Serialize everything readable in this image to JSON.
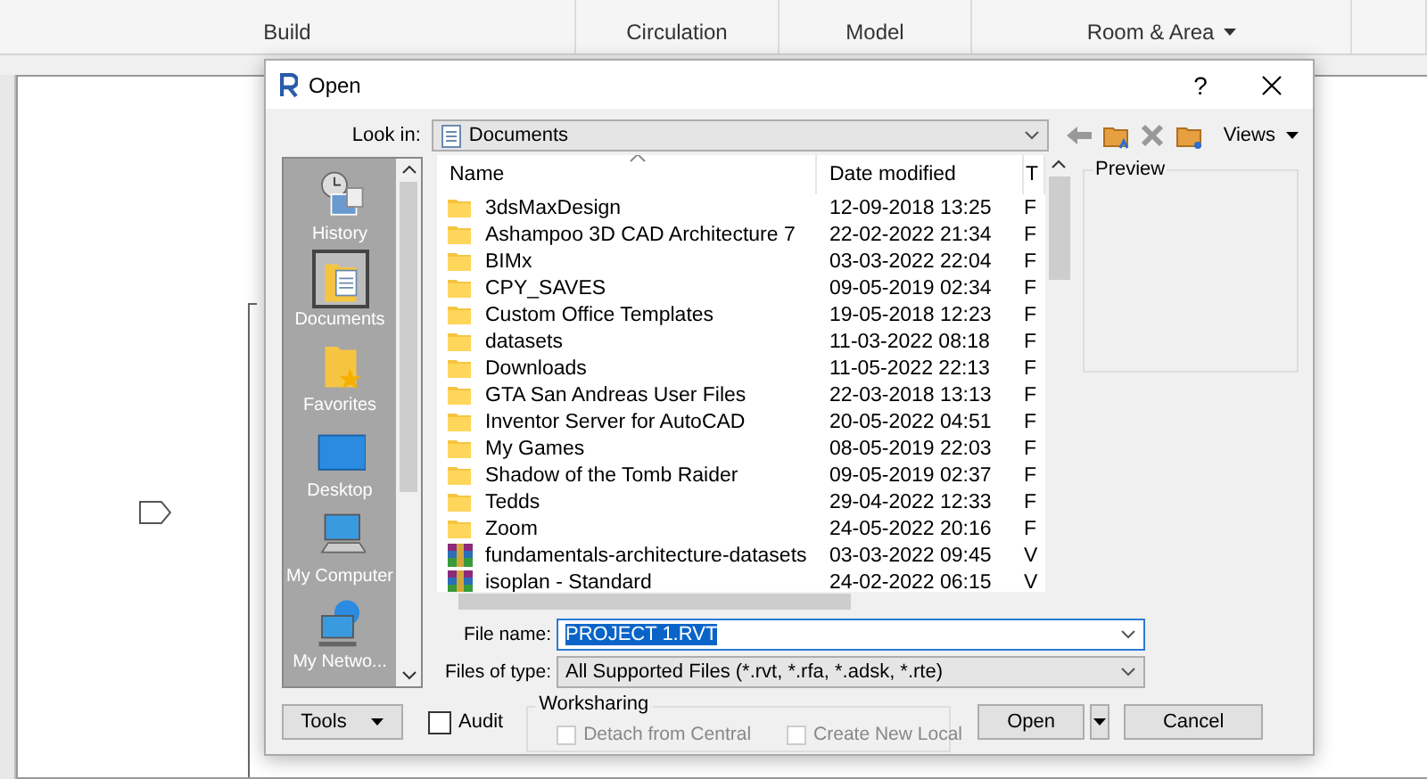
{
  "ribbon": {
    "groups": [
      {
        "label": "Build",
        "dropdown": false
      },
      {
        "label": "Circulation",
        "dropdown": false
      },
      {
        "label": "Model",
        "dropdown": false
      },
      {
        "label": "Room & Area",
        "dropdown": true
      }
    ]
  },
  "dialog": {
    "title": "Open",
    "help": "?",
    "look_in": {
      "label": "Look in:",
      "value": "Documents"
    },
    "views": "Views",
    "places": [
      {
        "label": "History",
        "selected": false
      },
      {
        "label": "Documents",
        "selected": true
      },
      {
        "label": "Favorites",
        "selected": false
      },
      {
        "label": "Desktop",
        "selected": false
      },
      {
        "label": "My Computer",
        "selected": false
      },
      {
        "label": "My Netwo...",
        "selected": false
      }
    ],
    "file_list": {
      "columns": [
        "Name",
        "Date modified",
        "T"
      ],
      "rows": [
        {
          "kind": "folder",
          "name": "3dsMaxDesign",
          "date": "12-09-2018 13:25",
          "column_3": "F"
        },
        {
          "kind": "folder",
          "name": "Ashampoo 3D CAD Architecture 7",
          "date": "22-02-2022 21:34",
          "column_3": "F"
        },
        {
          "kind": "folder",
          "name": "BIMx",
          "date": "03-03-2022 22:04",
          "column_3": "F"
        },
        {
          "kind": "folder",
          "name": "CPY_SAVES",
          "date": "09-05-2019 02:34",
          "column_3": "F"
        },
        {
          "kind": "folder",
          "name": "Custom Office Templates",
          "date": "19-05-2018 12:23",
          "column_3": "F"
        },
        {
          "kind": "folder",
          "name": "datasets",
          "date": "11-03-2022 08:18",
          "column_3": "F"
        },
        {
          "kind": "folder",
          "name": "Downloads",
          "date": "11-05-2022 22:13",
          "column_3": "F"
        },
        {
          "kind": "folder",
          "name": "GTA San Andreas User Files",
          "date": "22-03-2018 13:13",
          "column_3": "F"
        },
        {
          "kind": "folder",
          "name": "Inventor Server for AutoCAD",
          "date": "20-05-2022 04:51",
          "column_3": "F"
        },
        {
          "kind": "folder",
          "name": "My Games",
          "date": "08-05-2019 22:03",
          "column_3": "F"
        },
        {
          "kind": "folder",
          "name": "Shadow of the Tomb Raider",
          "date": "09-05-2019 02:37",
          "column_3": "F"
        },
        {
          "kind": "folder",
          "name": "Tedds",
          "date": "29-04-2022 12:33",
          "column_3": "F"
        },
        {
          "kind": "folder",
          "name": "Zoom",
          "date": "24-05-2022 20:16",
          "column_3": "F"
        },
        {
          "kind": "archive",
          "name": "fundamentals-architecture-datasets",
          "date": "03-03-2022 09:45",
          "column_3": "V"
        },
        {
          "kind": "archive",
          "name": "isoplan - Standard",
          "date": "24-02-2022 06:15",
          "column_3": "V"
        }
      ]
    },
    "preview": {
      "label": "Preview"
    },
    "file_name": {
      "label": "File name:",
      "value": "PROJECT 1.RVT"
    },
    "files_of_type": {
      "label": "Files of type:",
      "value": "All Supported Files  (*.rvt, *.rfa, *.adsk, *.rte)"
    },
    "tools": "Tools",
    "audit": {
      "label": "Audit",
      "checked": false
    },
    "worksharing": {
      "label": "Worksharing",
      "options": [
        {
          "label": "Detach from Central",
          "checked": false,
          "disabled": true
        },
        {
          "label": "Create New Local",
          "checked": false,
          "disabled": true
        }
      ]
    },
    "open": "Open",
    "cancel": "Cancel"
  }
}
